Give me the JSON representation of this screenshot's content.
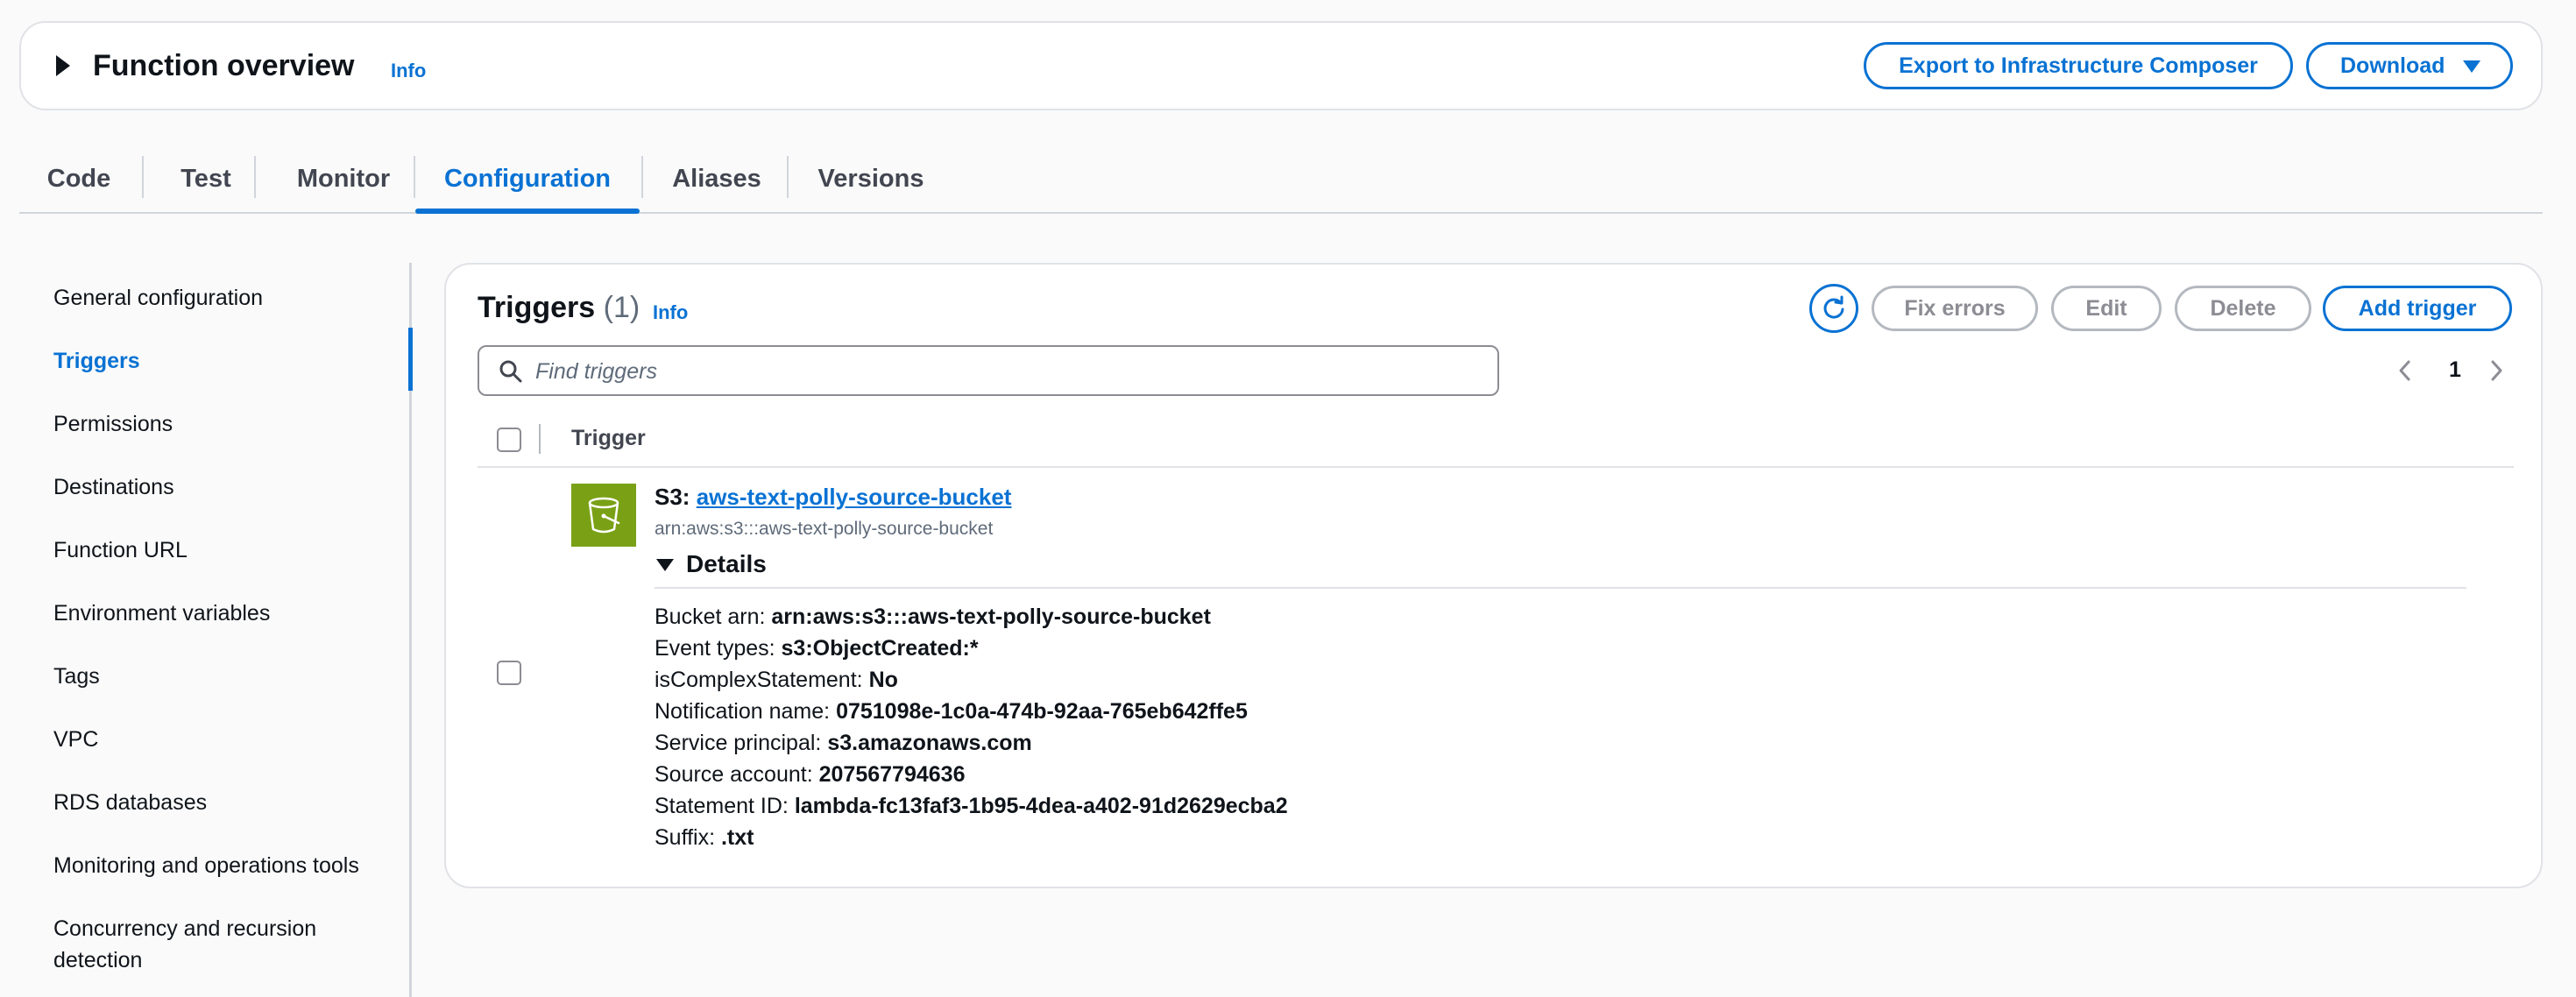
{
  "overview": {
    "title": "Function overview",
    "info": "Info",
    "export_label": "Export to Infrastructure Composer",
    "download_label": "Download"
  },
  "tabs": [
    {
      "label": "Code"
    },
    {
      "label": "Test"
    },
    {
      "label": "Monitor"
    },
    {
      "label": "Configuration",
      "active": true
    },
    {
      "label": "Aliases"
    },
    {
      "label": "Versions"
    }
  ],
  "sidebar": {
    "items": [
      {
        "label": "General configuration"
      },
      {
        "label": "Triggers",
        "active": true
      },
      {
        "label": "Permissions"
      },
      {
        "label": "Destinations"
      },
      {
        "label": "Function URL"
      },
      {
        "label": "Environment variables"
      },
      {
        "label": "Tags"
      },
      {
        "label": "VPC"
      },
      {
        "label": "RDS databases"
      },
      {
        "label": "Monitoring and operations tools"
      },
      {
        "label": "Concurrency and recursion detection"
      }
    ]
  },
  "triggers": {
    "title": "Triggers",
    "count": "(1)",
    "info": "Info",
    "buttons": {
      "fix_errors": "Fix errors",
      "edit": "Edit",
      "delete": "Delete",
      "add": "Add trigger"
    },
    "search_placeholder": "Find triggers",
    "page": "1",
    "column_header": "Trigger",
    "item": {
      "type_prefix": "S3:",
      "name": "aws-text-polly-source-bucket",
      "arn": "arn:aws:s3:::aws-text-polly-source-bucket",
      "details_label": "Details",
      "details": [
        {
          "key": "Bucket arn:",
          "value": "arn:aws:s3:::aws-text-polly-source-bucket"
        },
        {
          "key": "Event types:",
          "value": "s3:ObjectCreated:*"
        },
        {
          "key": "isComplexStatement:",
          "value": "No"
        },
        {
          "key": "Notification name:",
          "value": "0751098e-1c0a-474b-92aa-765eb642ffe5"
        },
        {
          "key": "Service principal:",
          "value": "s3.amazonaws.com"
        },
        {
          "key": "Source account:",
          "value": "207567794636"
        },
        {
          "key": "Statement ID:",
          "value": "lambda-fc13faf3-1b95-4dea-a402-91d2629ecba2"
        },
        {
          "key": "Suffix:",
          "value": ".txt"
        }
      ]
    }
  },
  "colors": {
    "accent": "#0972d3",
    "s3_icon": "#7aa116",
    "disabled": "#8c8c94"
  }
}
